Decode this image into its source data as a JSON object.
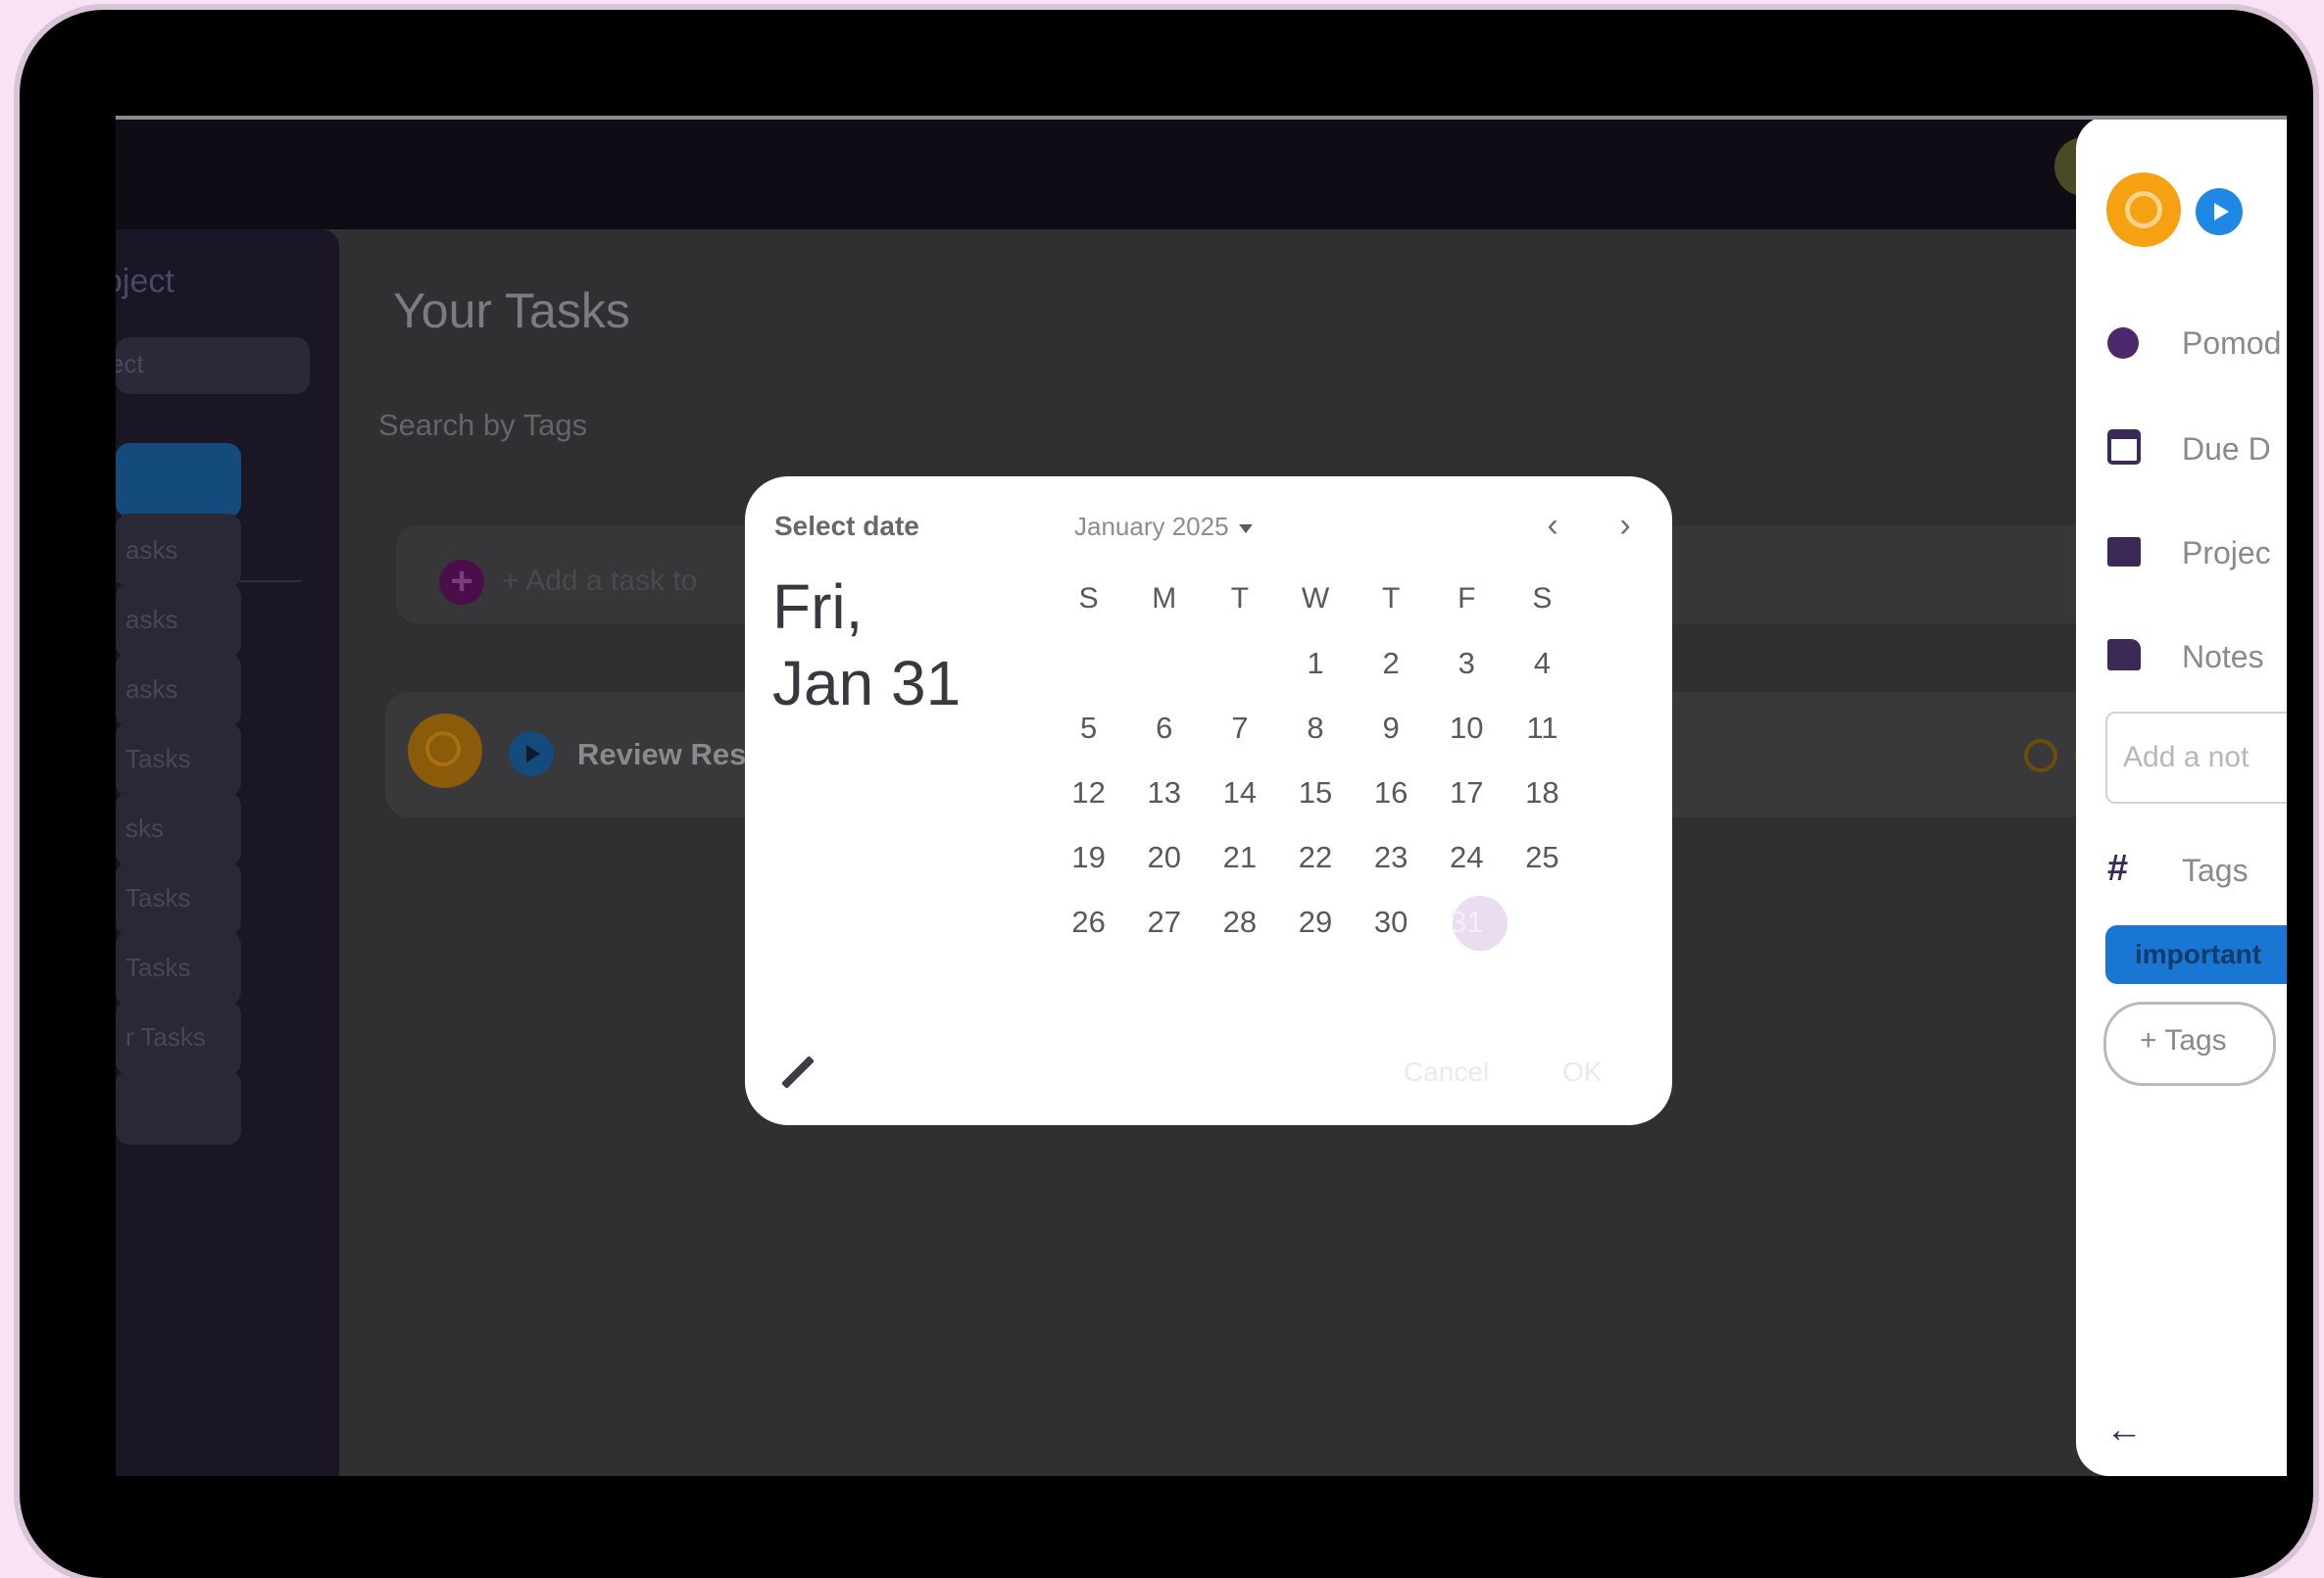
{
  "app": {
    "main_title": "Your Tasks",
    "search_label": "Search by Tags",
    "add_task_placeholder": "+ Add a task to",
    "task_title": "Review Res"
  },
  "left_panel": {
    "title_fragment": "oject",
    "input_fragment": "ect",
    "buttons": [
      "",
      "asks",
      "asks",
      "asks",
      "Tasks",
      "sks",
      "Tasks",
      "Tasks",
      "r Tasks"
    ]
  },
  "right_panel": {
    "items": [
      {
        "icon": "stopwatch-icon",
        "label": "Pomod"
      },
      {
        "icon": "calendar-icon",
        "label": "Due D"
      },
      {
        "icon": "folder-icon",
        "label": "Projec"
      },
      {
        "icon": "note-icon",
        "label": "Notes"
      }
    ],
    "note_placeholder": "Add a not",
    "tags_label": "Tags",
    "tag_chip": "important",
    "add_tag_label": "+ Tags",
    "back_glyph": "←"
  },
  "date_picker": {
    "label": "Select date",
    "selected_date": "Fri, Jan 31",
    "month_label": "January 2025",
    "prev_glyph": "‹",
    "next_glyph": "›",
    "weekdays": [
      "S",
      "M",
      "T",
      "W",
      "T",
      "F",
      "S"
    ],
    "weeks": [
      [
        "",
        "",
        "",
        "1",
        "2",
        "3",
        "4"
      ],
      [
        "5",
        "6",
        "7",
        "8",
        "9",
        "10",
        "11"
      ],
      [
        "12",
        "13",
        "14",
        "15",
        "16",
        "17",
        "18"
      ],
      [
        "19",
        "20",
        "21",
        "22",
        "23",
        "24",
        "25"
      ],
      [
        "26",
        "27",
        "28",
        "29",
        "30",
        "31",
        ""
      ]
    ],
    "selected_day": "31",
    "cancel_label": "Cancel",
    "ok_label": "OK"
  }
}
